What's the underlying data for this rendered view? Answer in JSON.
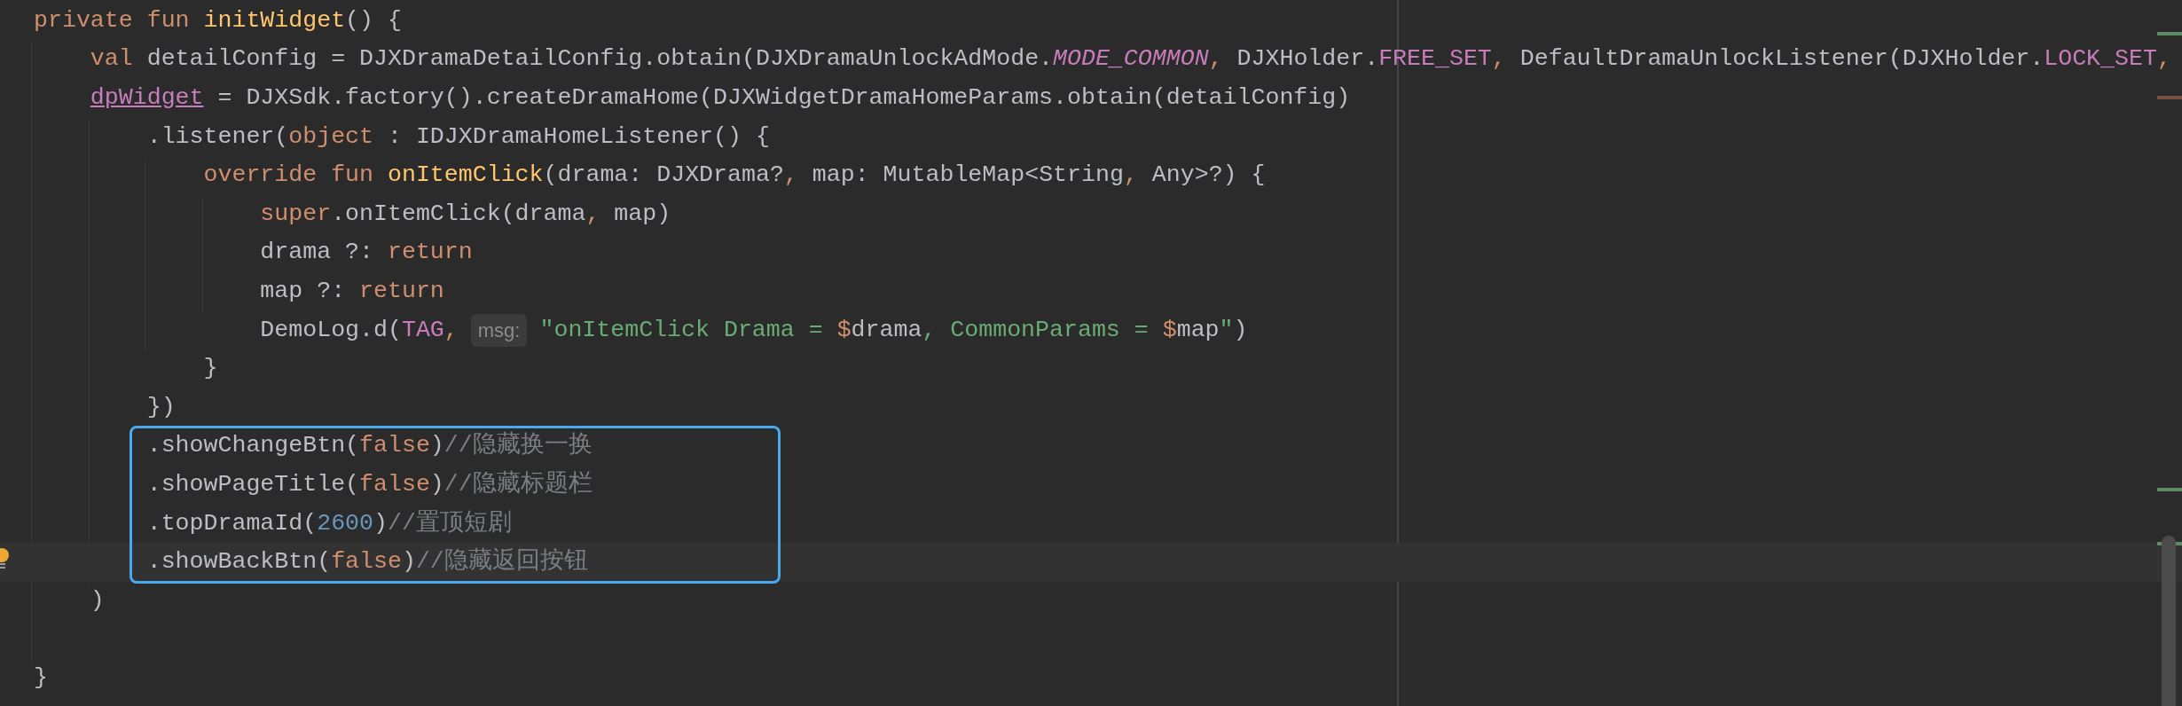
{
  "editor": {
    "blocks": [
      {
        "kind": "plain",
        "lines": [
          {
            "current": false,
            "tokens": [
              {
                "kind": "keyword",
                "text": "private fun "
              },
              {
                "kind": "decl",
                "text": "initWidget"
              },
              {
                "kind": "plain",
                "text": "() {"
              }
            ]
          },
          {
            "current": false,
            "tokens": [
              {
                "kind": "keyword",
                "text": "    val"
              },
              {
                "kind": "plain",
                "text": " detailConfig = DJXDramaDetailConfig.obtain(DJXDramaUnlockAdMode."
              },
              {
                "kind": "static",
                "text": "MODE_COMMON"
              },
              {
                "kind": "separator",
                "text": ","
              },
              {
                "kind": "plain",
                "text": " DJXHolder."
              },
              {
                "kind": "const",
                "text": "FREE_SET"
              },
              {
                "kind": "separator",
                "text": ","
              },
              {
                "kind": "plain",
                "text": " DefaultDramaUnlockListener(DJXHolder."
              },
              {
                "kind": "const",
                "text": "LOCK_SET"
              },
              {
                "kind": "separator",
                "text": ","
              }
            ]
          },
          {
            "current": false,
            "tokens": [
              {
                "kind": "property",
                "text": "    dpWidget"
              },
              {
                "kind": "plain",
                "text": " = DJXSdk.factory().createDramaHome(DJXWidgetDramaHomeParams.obtain(detailConfig)"
              }
            ]
          },
          {
            "current": false,
            "tokens": [
              {
                "kind": "plain",
                "text": "        .listener("
              },
              {
                "kind": "keyword",
                "text": "object"
              },
              {
                "kind": "plain",
                "text": " : IDJXDramaHomeListener() {"
              }
            ]
          },
          {
            "current": false,
            "tokens": [
              {
                "kind": "keyword",
                "text": "            override fun "
              },
              {
                "kind": "decl",
                "text": "onItemClick"
              },
              {
                "kind": "plain",
                "text": "(drama: DJXDrama?"
              },
              {
                "kind": "separator",
                "text": ","
              },
              {
                "kind": "plain",
                "text": " map: MutableMap<String"
              },
              {
                "kind": "separator",
                "text": ","
              },
              {
                "kind": "plain",
                "text": " Any>?) {"
              }
            ]
          },
          {
            "current": false,
            "tokens": [
              {
                "kind": "keyword",
                "text": "                super"
              },
              {
                "kind": "plain",
                "text": ".onItemClick(drama"
              },
              {
                "kind": "separator",
                "text": ","
              },
              {
                "kind": "plain",
                "text": " map)"
              }
            ]
          },
          {
            "current": false,
            "tokens": [
              {
                "kind": "plain",
                "text": "                drama ?: "
              },
              {
                "kind": "keyword",
                "text": "return"
              }
            ]
          },
          {
            "current": false,
            "tokens": [
              {
                "kind": "plain",
                "text": "                map ?: "
              },
              {
                "kind": "keyword",
                "text": "return"
              }
            ]
          },
          {
            "current": false,
            "tokens": [
              {
                "kind": "plain",
                "text": "                DemoLog.d("
              },
              {
                "kind": "const",
                "text": "TAG"
              },
              {
                "kind": "separator",
                "text": ","
              },
              {
                "kind": "hint",
                "text": "msg:"
              },
              {
                "kind": "string",
                "text": "\"onItemClick Drama = "
              },
              {
                "kind": "template",
                "text": "$"
              },
              {
                "kind": "plain",
                "text": "drama"
              },
              {
                "kind": "string",
                "text": ", CommonParams = "
              },
              {
                "kind": "template",
                "text": "$"
              },
              {
                "kind": "plain",
                "text": "map"
              },
              {
                "kind": "string",
                "text": "\""
              },
              {
                "kind": "plain",
                "text": ")"
              }
            ]
          },
          {
            "current": false,
            "tokens": [
              {
                "kind": "plain",
                "text": "            }"
              }
            ]
          },
          {
            "current": false,
            "tokens": [
              {
                "kind": "plain",
                "text": "        })"
              }
            ]
          }
        ]
      },
      {
        "kind": "boxed",
        "lines": [
          {
            "current": false,
            "tokens": [
              {
                "kind": "plain",
                "text": "        .showChangeBtn("
              },
              {
                "kind": "keyword",
                "text": "false"
              },
              {
                "kind": "plain",
                "text": ")"
              },
              {
                "kind": "comment",
                "text": "//隐藏换一换"
              }
            ]
          },
          {
            "current": false,
            "tokens": [
              {
                "kind": "plain",
                "text": "        .showPageTitle("
              },
              {
                "kind": "keyword",
                "text": "false"
              },
              {
                "kind": "plain",
                "text": ")"
              },
              {
                "kind": "comment",
                "text": "//隐藏标题栏"
              }
            ]
          },
          {
            "current": false,
            "tokens": [
              {
                "kind": "plain",
                "text": "        .topDramaId("
              },
              {
                "kind": "number",
                "text": "2600"
              },
              {
                "kind": "plain",
                "text": ")"
              },
              {
                "kind": "comment",
                "text": "//置顶短剧"
              }
            ]
          },
          {
            "current": true,
            "tokens": [
              {
                "kind": "plain",
                "text": "        .showBackBtn("
              },
              {
                "kind": "keyword",
                "text": "false"
              },
              {
                "kind": "plain",
                "text": ")"
              },
              {
                "kind": "comment",
                "text": "//隐藏返回按钮"
              }
            ]
          }
        ]
      },
      {
        "kind": "plain",
        "lines": [
          {
            "current": false,
            "tokens": [
              {
                "kind": "plain",
                "text": "    )"
              }
            ]
          },
          {
            "current": false
          },
          {
            "current": false,
            "tokens": [
              {
                "kind": "plain",
                "text": "}"
              }
            ]
          }
        ]
      }
    ]
  }
}
